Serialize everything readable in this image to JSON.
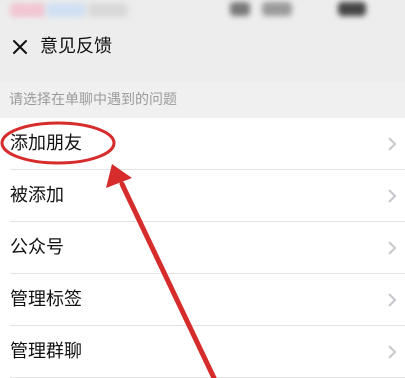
{
  "nav": {
    "title": "意见反馈",
    "close_icon": "close-icon"
  },
  "hint": "请选择在单聊中遇到的问题",
  "items": [
    {
      "label": "添加朋友"
    },
    {
      "label": "被添加"
    },
    {
      "label": "公众号"
    },
    {
      "label": "管理标签"
    },
    {
      "label": "管理群聊"
    }
  ],
  "icons": {
    "row_chevron": "chevron-right-icon"
  },
  "colors": {
    "annotation": "#d62c2c",
    "background": "#ededed",
    "row_bg": "#ffffff",
    "chevron": "#c7c7cc"
  }
}
